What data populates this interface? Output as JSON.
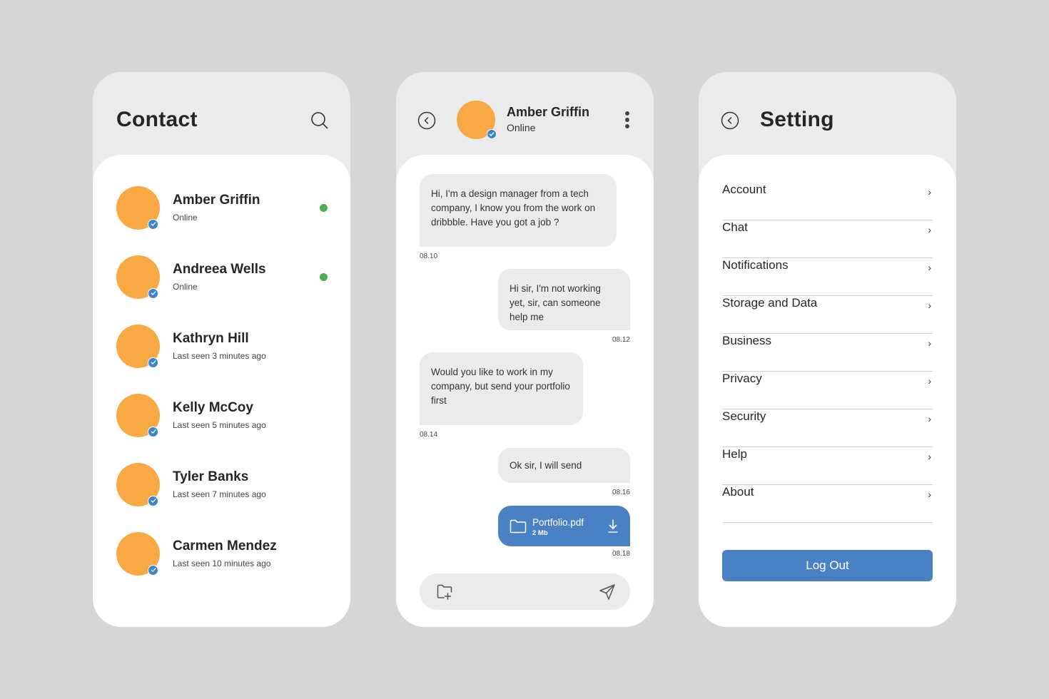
{
  "contact_screen": {
    "title": "Contact",
    "search_icon": "search-icon",
    "contacts": [
      {
        "name": "Amber Griffin",
        "status": "Online",
        "online": true
      },
      {
        "name": "Andreea Wells",
        "status": "Online",
        "online": true
      },
      {
        "name": "Kathryn Hill",
        "status": "Last seen 3 minutes ago",
        "online": false
      },
      {
        "name": "Kelly McCoy",
        "status": "Last seen 5 minutes ago",
        "online": false
      },
      {
        "name": "Tyler Banks",
        "status": "Last seen 7 minutes ago",
        "online": false
      },
      {
        "name": "Carmen Mendez",
        "status": "Last seen 10 minutes ago",
        "online": false
      }
    ]
  },
  "chat_screen": {
    "contact_name": "Amber Griffin",
    "contact_status": "Online",
    "messages": [
      {
        "direction": "in",
        "text": "Hi, I'm a design manager from a tech company, I know you from the work on dribbble. Have you got a job ?",
        "time": "08.10"
      },
      {
        "direction": "out",
        "text": "Hi sir, I'm not working yet, sir, can someone help me",
        "time": "08.12"
      },
      {
        "direction": "in",
        "text": "Would you like to work in my company, but send your portfolio first",
        "time": "08.14"
      },
      {
        "direction": "out",
        "text": "Ok sir, I will send",
        "time": "08.16"
      }
    ],
    "file_message": {
      "file_name": "Portfolio.pdf",
      "file_size": "2 Mb",
      "time": "08.18"
    },
    "composer": {
      "attach_icon": "folder-plus-icon",
      "send_icon": "send-icon"
    }
  },
  "setting_screen": {
    "title": "Setting",
    "items": [
      "Account",
      "Chat",
      "Notifications",
      "Storage and Data",
      "Business",
      "Privacy",
      "Security",
      "Help",
      "About"
    ],
    "logout_label": "Log Out"
  },
  "colors": {
    "background": "#d5d6d6",
    "panel_header": "#ebebeb",
    "avatar": "#f8a944",
    "accent_blue": "#4a80c4",
    "verified_badge": "#3a86c8",
    "online_dot": "#4caf50"
  }
}
